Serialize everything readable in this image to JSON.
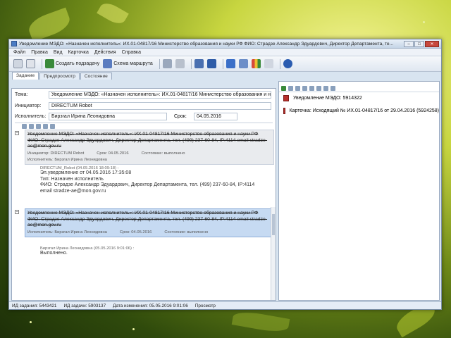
{
  "window": {
    "title": "Уведомление МЭДО: «Назначен исполнитель»: ИХ.01-04817/16 Министерство образования и науки РФ ФИО: Страдзе Александр Эдуардович, Директор Департамента, те..."
  },
  "menu": [
    "Файл",
    "Правка",
    "Вид",
    "Карточка",
    "Действия",
    "Справка"
  ],
  "toolbar": {
    "create_subtask": "Создать подзадачу",
    "route_scheme": "Схема маршрута"
  },
  "tabs": [
    "Задание",
    "Предпросмотр",
    "Состояние"
  ],
  "form": {
    "topic_label": "Тема:",
    "topic_value": "Уведомление МЭДО: «Назначен исполнитель»: ИХ.01-04817/16 Министерство образования и на",
    "initiator_label": "Инициатор:",
    "initiator_value": "DIRECTUM Robot",
    "executor_label": "Исполнитель:",
    "executor_value": "Бирзгал Ирина Леонидовна",
    "deadline_label": "Срок:",
    "deadline_value": "04.05.2016"
  },
  "messages": [
    {
      "head": "Уведомление МЭДО: «Назначен исполнитель»: ИХ.01-04817/16 Министерство образования и науки РФ ФИО: Страдзе Александр Эдуардович, Директор Департамента, тел. (499) 237-60-84, IP:4114 email stradze-ae@mon.gov.ru",
      "author_label": "Инициатор: DIRECTUM Robot",
      "executor_label": "Исполнитель: Бирзгал Ирина Леонидовна",
      "deadline": "Срок: 04.05.2016",
      "state": "Состояние: выполнено"
    },
    {
      "head": "Уведомление МЭДО: «Назначен исполнитель»: ИХ.01-04817/16 Министерство образования и науки РФ ФИО: Страдзе Александр Эдуардович, Директор Департамента, тел. (499) 237-60-84, IP:4114 email stradze-ae@mon.gov.ru",
      "author_label": "Исполнитель: Бирзгал Ирина Леонидовна",
      "deadline": "Срок: 04.05.2016",
      "state": "Состояние: выполнено"
    }
  ],
  "comments": [
    {
      "who": "DIRECTUM_Robot (04.05.2016 18:09:18) :",
      "lines": [
        "Эл.уведомление от 04.05.2016 17:35:08",
        "Тип: Назначен исполнитель",
        "ФИО: Страдзе Александр Эдуардович, Директор Департамента, тел. (499) 237-60-84, IP:4114",
        "email stradze-ae@mon.gov.ru"
      ]
    },
    {
      "who": "Бирзгал Ирина Леонидовна (05.05.2016 9:01:06) :",
      "lines": [
        "Выполнено."
      ]
    }
  ],
  "attachments": [
    "Уведомление МЭДО: 5914322",
    "Карточка: Исходящий № ИХ.01-04817/16 от 29.04.2016 (5924258)"
  ],
  "status": {
    "task_id": "ИД задания: 5443421",
    "job_id": "ИД задачи: 5903137",
    "changed": "Дата изменения: 05.05.2016 9:01:06",
    "mode": "Просмотр"
  }
}
